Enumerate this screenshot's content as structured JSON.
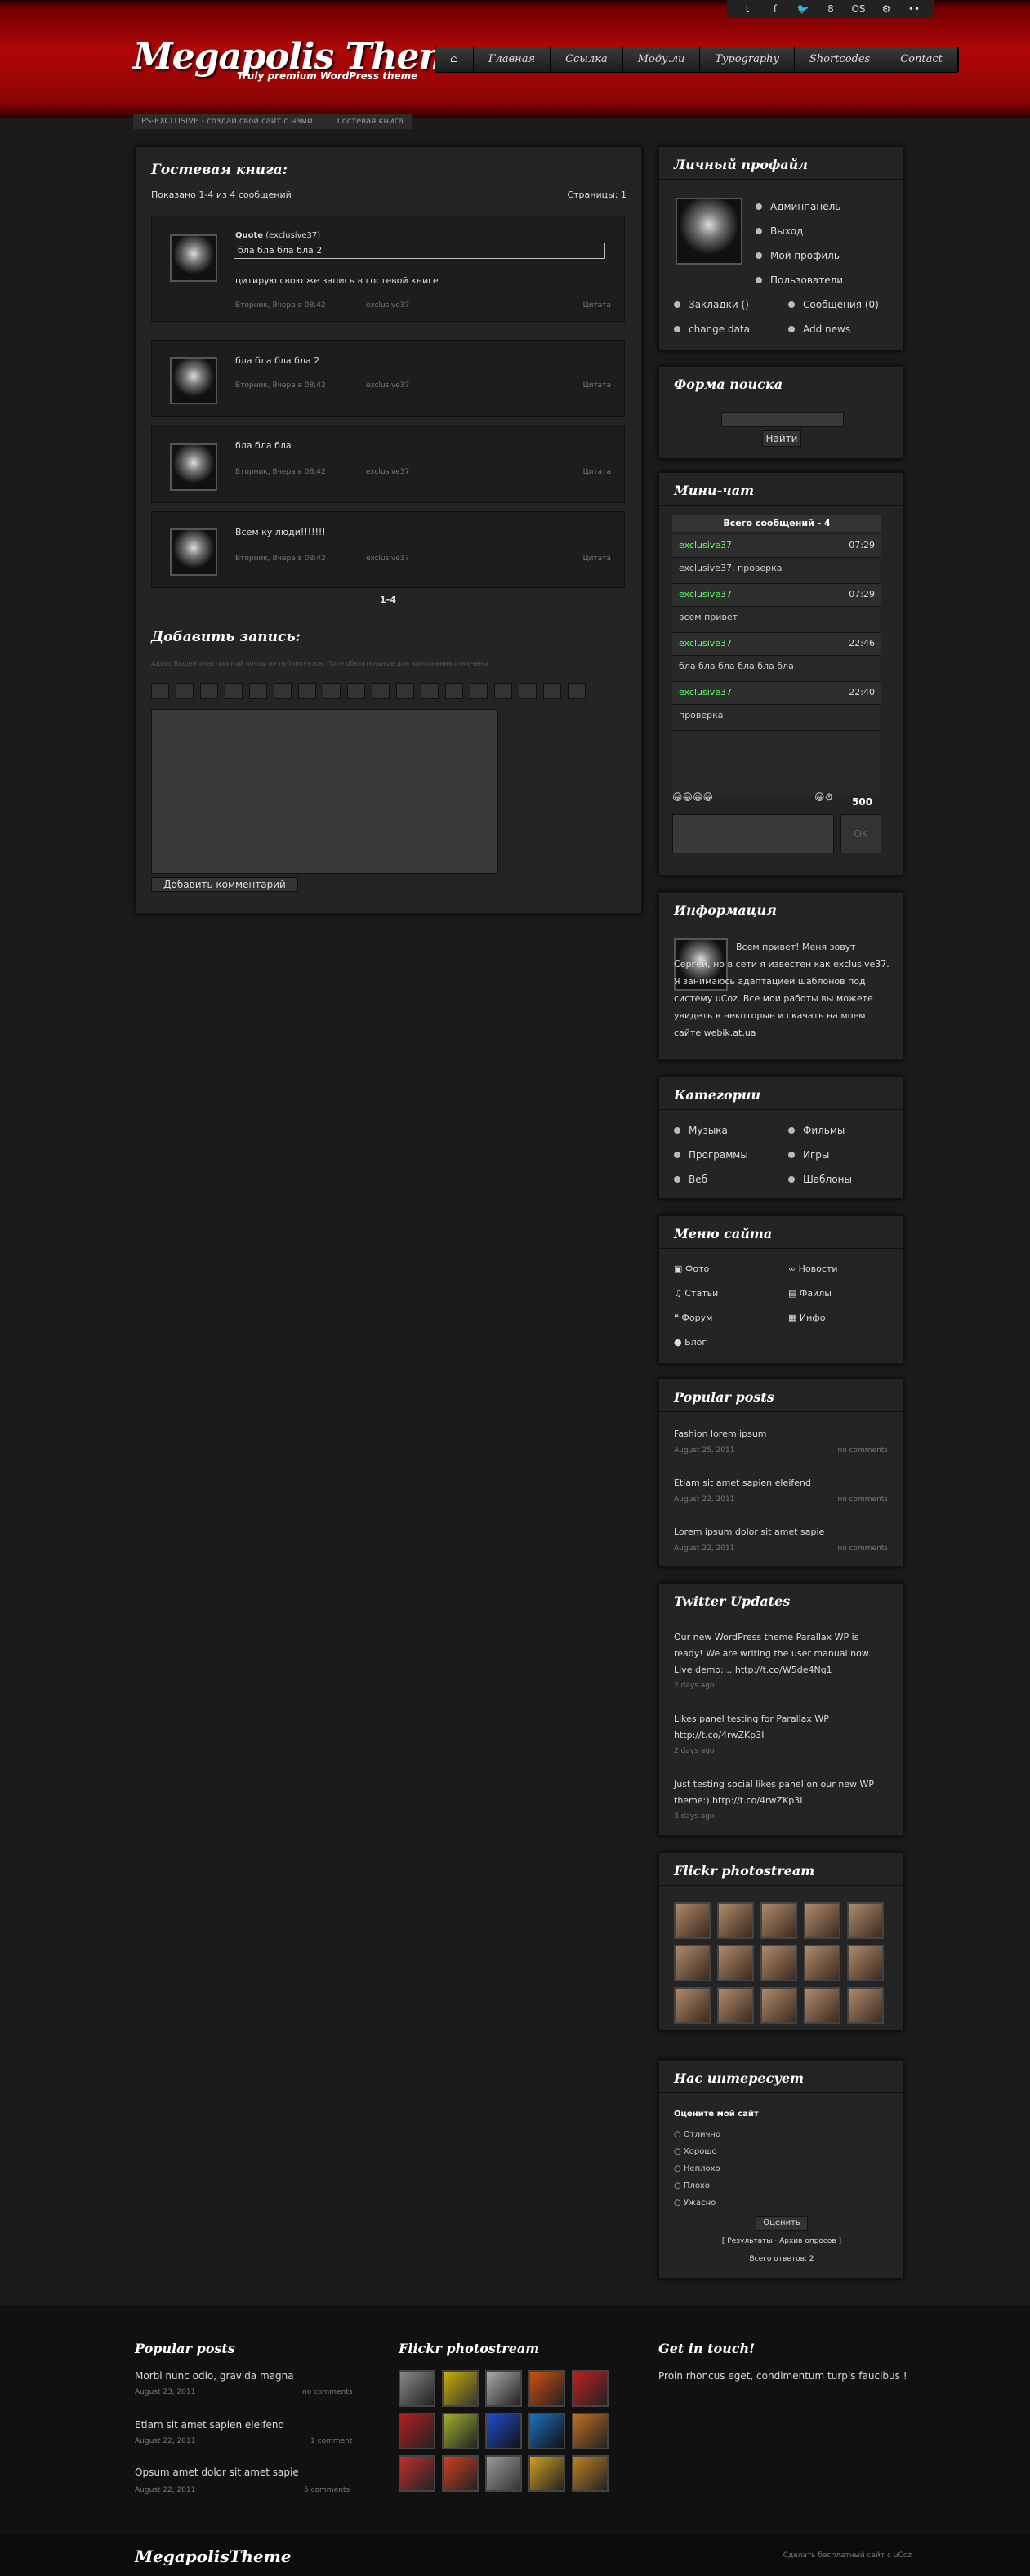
{
  "topbar_icons": [
    "t",
    "f",
    "🐦",
    "8",
    "OS",
    "⚙",
    "••"
  ],
  "header": {
    "logo": "Megapolis Theme",
    "tagline": "Truly premium WordPress theme"
  },
  "nav": [
    "⌂",
    "Главная",
    "Ссылка",
    "Моду.ли",
    "Typography",
    "Shortcodes",
    "Contact"
  ],
  "breadcrumb": [
    "PS-EXCLUSIVE - создай свой сайт с нами",
    "Гостевая книга"
  ],
  "guestbook": {
    "title": "Гостевая книга:",
    "shown": "Показано 1-4 из 4 сообщений",
    "pages": "Страницы: 1",
    "entries": [
      {
        "text": "бла бла бла бла 2",
        "quote_label": "Quote",
        "quote_user": "(exclusive37)",
        "quote_text": "бла бла бла бла 2",
        "extra": "цитирую свою же запись в гостевой книге",
        "date": "Вторник, Вчера в 08:42",
        "user": "exclusive37",
        "action": "Цитата"
      },
      {
        "text": "бла бла бла бла 2",
        "date": "Вторник, Вчера в 08:42",
        "user": "exclusive37",
        "action": "Цитата"
      },
      {
        "text": "бла бла бла",
        "date": "Вторник, Вчера в 08:42",
        "user": "exclusive37",
        "action": "Цитата"
      },
      {
        "text": "Всем ку люди!!!!!!!",
        "date": "Вторник, Вчера в 08:42",
        "user": "exclusive37",
        "action": "Цитата"
      }
    ],
    "pager": "1-4",
    "add_title": "Добавить запись:",
    "add_note": "Адрес Вашей электронной почты не публикуется. Поля обязательные для заполнения отмечены",
    "submit": "- Добавить комментарий -"
  },
  "profile": {
    "title": "Личный профайл",
    "items": [
      "Админпанель",
      "Выход",
      "Мой профиль",
      "Пользователи"
    ],
    "links": [
      "Закладки ()",
      "Сообщения (0)",
      "change data",
      "Add news"
    ]
  },
  "search": {
    "title": "Форма поиска",
    "button": "Найти"
  },
  "chat": {
    "title": "Мини-чат",
    "total": "Всего сообщений - 4",
    "rows": [
      {
        "user": "exclusive37",
        "time": "07:29"
      },
      {
        "text": "exclusive37, проверка"
      },
      {
        "user": "exclusive37",
        "time": "07:29"
      },
      {
        "text": "всем привет"
      },
      {
        "user": "exclusive37",
        "time": "22:46"
      },
      {
        "text": "бла бла бла бла бла бла"
      },
      {
        "user": "exclusive37",
        "time": "22:40"
      },
      {
        "text": "проверка"
      }
    ],
    "count": "500",
    "ok": "OK"
  },
  "info": {
    "title": "Информация",
    "text": "Всем привет! Меня зовут Сергей, но в сети я известен как exclusive37. Я занимаюсь адаптацией шаблонов под систему uCoz. Все мои работы вы можете увидеть в некоторые и скачать на моем сайте webik.at.ua"
  },
  "categories": {
    "title": "Категории",
    "items": [
      "Музыка",
      "Фильмы",
      "Программы",
      "Игры",
      "Веб",
      "Шаблоны"
    ]
  },
  "menu": {
    "title": "Меню сайта",
    "items": [
      "Фото",
      "Новости",
      "Статьи",
      "Файлы",
      "Форум",
      "Инфо",
      "Блог"
    ]
  },
  "popular": {
    "title": "Popular posts",
    "posts": [
      {
        "t": "Fashion lorem ipsum",
        "d": "August 25, 2011",
        "c": "no comments"
      },
      {
        "t": "Etiam sit amet sapien eleifend",
        "d": "August 22, 2011",
        "c": "no comments"
      },
      {
        "t": "Lorem ipsum dolor sit amet sapie",
        "d": "August 22, 2011",
        "c": "no comments"
      }
    ]
  },
  "twitter": {
    "title": "Twitter Updates",
    "tweets": [
      {
        "t": "Our new WordPress theme Parallax WP is ready! We are writing the user manual now. Live demo:... http://t.co/W5de4Nq1",
        "d": "2 days ago"
      },
      {
        "t": "Likes panel testing for Parallax WP http://t.co/4rwZKp3I",
        "d": "2 days ago"
      },
      {
        "t": "Just testing social likes panel on our new WP theme:) http://t.co/4rwZKp3I",
        "d": "3 days ago"
      }
    ]
  },
  "flickr": {
    "title": "Flickr photostream"
  },
  "poll": {
    "title": "Нас интересует",
    "q": "Оцените мой сайт",
    "opts": [
      "Отлично",
      "Хорошо",
      "Неплохо",
      "Плохо",
      "Ужасно"
    ],
    "vote": "Оценить",
    "links": "[ Результаты · Архив опросов ]",
    "total": "Всего ответов: 2"
  },
  "footer": {
    "popular_title": "Popular posts",
    "posts": [
      {
        "t": "Morbi nunc odio, gravida magna",
        "d": "August 23, 2011",
        "c": "no comments"
      },
      {
        "t": "Etiam sit amet sapien eleifend",
        "d": "August 22, 2011",
        "c": "1 comment"
      },
      {
        "t": "Opsum amet dolor sit amet sapie",
        "d": "August 22, 2011",
        "c": "5 comments"
      }
    ],
    "flickr_title": "Flickr photostream",
    "touch_title": "Get in touch!",
    "touch_text": "Proin rhoncus eget, condimentum turpis faucibus !",
    "logo": "MegapolisTheme",
    "right": "Сделать бесплатный сайт с uCoz"
  }
}
